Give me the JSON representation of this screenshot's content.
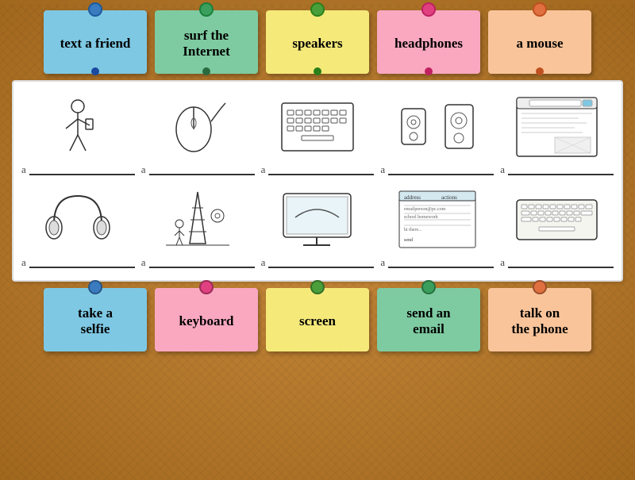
{
  "top_notes": [
    {
      "id": "text-friend",
      "label": "text a\nfriend",
      "color": "note-blue"
    },
    {
      "id": "surf-internet",
      "label": "surf the\nInternet",
      "color": "note-green"
    },
    {
      "id": "speakers",
      "label": "speakers",
      "color": "note-yellow"
    },
    {
      "id": "headphones",
      "label": "headphones",
      "color": "note-pink"
    },
    {
      "id": "a-mouse",
      "label": "a mouse",
      "color": "note-peach"
    }
  ],
  "bottom_notes": [
    {
      "id": "take-selfie",
      "label": "take a\nselfie",
      "color": "note-blue"
    },
    {
      "id": "keyboard",
      "label": "keyboard",
      "color": "note-pink"
    },
    {
      "id": "screen",
      "label": "screen",
      "color": "note-yellow"
    },
    {
      "id": "send-email",
      "label": "send an\nemail",
      "color": "note-green"
    },
    {
      "id": "talk-phone",
      "label": "talk on\nthe phone",
      "color": "note-peach"
    }
  ],
  "images": [
    {
      "id": "person-selfie",
      "type": "person"
    },
    {
      "id": "mouse-img",
      "type": "mouse"
    },
    {
      "id": "keyboard-img",
      "type": "keyboard-top"
    },
    {
      "id": "speakers-img",
      "type": "speakers"
    },
    {
      "id": "browser-img",
      "type": "browser"
    },
    {
      "id": "headphones-img",
      "type": "headphones"
    },
    {
      "id": "paris-img",
      "type": "paris"
    },
    {
      "id": "screen-img",
      "type": "screen"
    },
    {
      "id": "email-img",
      "type": "email"
    },
    {
      "id": "keyboard-img2",
      "type": "keyboard"
    }
  ],
  "pin_colors": {
    "top": [
      "#1a4a9f",
      "#2a6a3f",
      "#2a7f1a",
      "#c02060",
      "#c05020"
    ],
    "bottom": [
      "#1a4a9f",
      "#c02060",
      "#2a7f1a",
      "#1a6a3f",
      "#c05020"
    ]
  }
}
